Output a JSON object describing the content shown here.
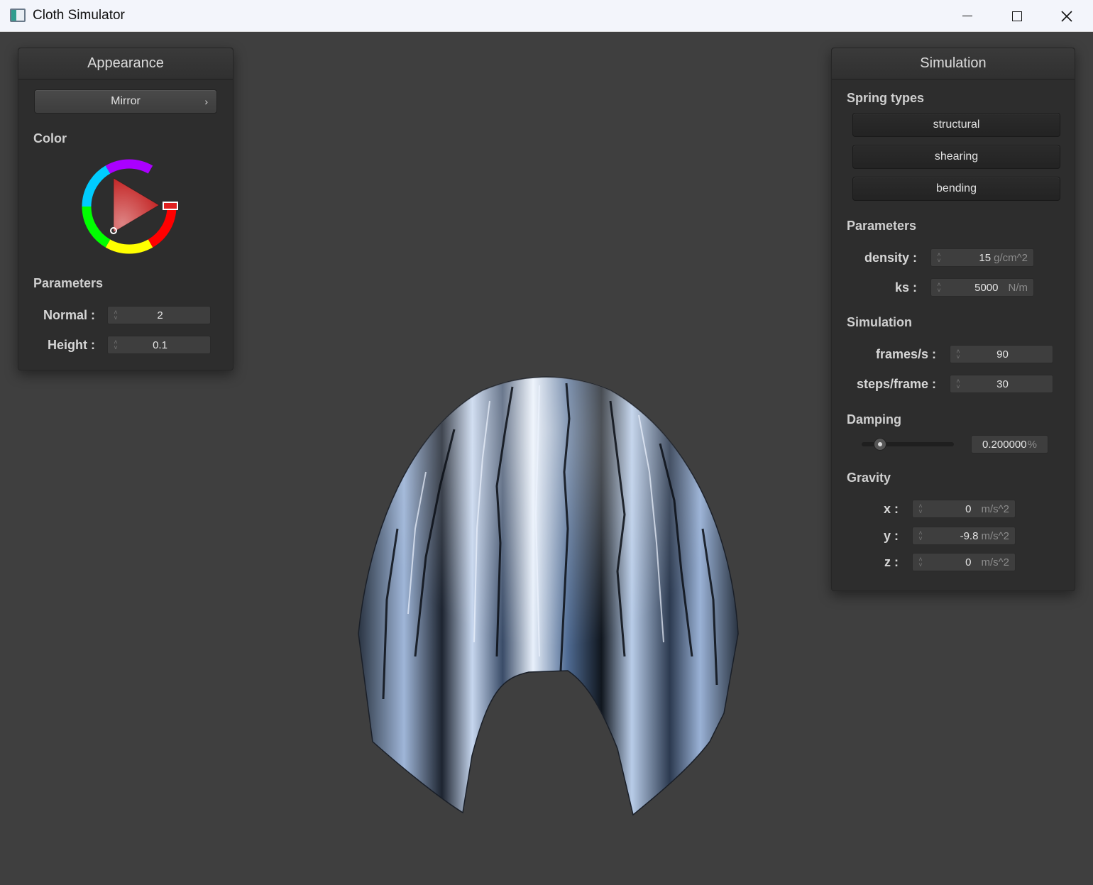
{
  "window": {
    "title": "Cloth Simulator",
    "icon": "app-window-icon"
  },
  "appearance": {
    "header": "Appearance",
    "shader_selector": "Mirror",
    "color_label": "Color",
    "selected_color": "#e02020",
    "parameters_label": "Parameters",
    "normal": {
      "label": "Normal :",
      "value": "2"
    },
    "height": {
      "label": "Height :",
      "value": "0.1"
    }
  },
  "simulation": {
    "header": "Simulation",
    "spring_types_label": "Spring types",
    "spring_buttons": [
      "structural",
      "shearing",
      "bending"
    ],
    "parameters_label": "Parameters",
    "density": {
      "label": "density :",
      "value": "15",
      "unit": "g/cm^2"
    },
    "ks": {
      "label": "ks :",
      "value": "5000",
      "unit": "N/m"
    },
    "simulation_label": "Simulation",
    "frames": {
      "label": "frames/s :",
      "value": "90"
    },
    "steps": {
      "label": "steps/frame :",
      "value": "30"
    },
    "damping_label": "Damping",
    "damping": {
      "value": "0.200000",
      "unit": "%",
      "slider_fraction": 0.2
    },
    "gravity_label": "Gravity",
    "gx": {
      "label": "x :",
      "value": "0",
      "unit": "m/s^2"
    },
    "gy": {
      "label": "y :",
      "value": "-9.8",
      "unit": "m/s^2"
    },
    "gz": {
      "label": "z :",
      "value": "0",
      "unit": "m/s^2"
    }
  },
  "colors": {
    "panel_bg": "#2d2d2d",
    "viewport_bg": "#3f3f3f",
    "cloth_tint": "#6f8fc4"
  }
}
